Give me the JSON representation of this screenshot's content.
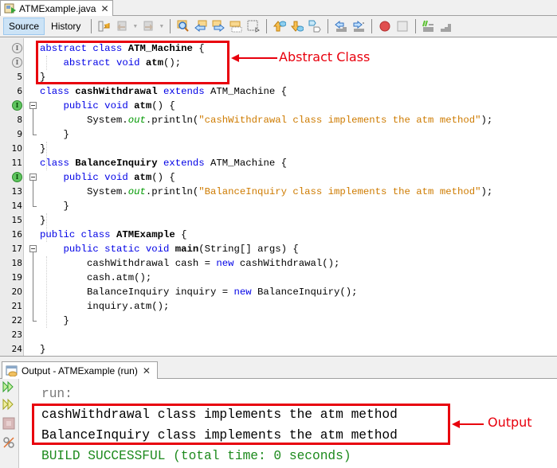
{
  "editor_tab": {
    "filename": "ATMExample.java",
    "close_glyph": "✕",
    "icon": "java-file-icon"
  },
  "toolbar": {
    "source_label": "Source",
    "history_label": "History",
    "icons": [
      "last-edit-icon",
      "back-icon",
      "forward-icon",
      "find-icon",
      "find-previous-icon",
      "find-next-icon",
      "toggle-highlight-icon",
      "rect-select-icon",
      "previous-bookmark-icon",
      "next-bookmark-icon",
      "toggle-bookmark-icon",
      "shift-left-icon",
      "shift-right-icon",
      "start-macro-icon",
      "stop-macro-icon",
      "comment-icon",
      "uncomment-icon"
    ]
  },
  "code": {
    "lines": [
      {
        "n": "",
        "badge": "gray",
        "html": "<span class='kw'>abstract class</span> <span class='b'>ATM_Machine</span> {"
      },
      {
        "n": "",
        "badge": "gray",
        "html": "    <span class='kw'>abstract void</span> <span class='b'>atm</span>();"
      },
      {
        "n": "5",
        "html": "}"
      },
      {
        "n": "6",
        "html": "<span class='kw'>class</span> <span class='b'>cashWithdrawal</span> <span class='kw'>extends</span> ATM_Machine {"
      },
      {
        "n": "",
        "badge": "green",
        "fold": "start",
        "html": "    <span class='kw'>public void</span> <span class='b'>atm</span>() {"
      },
      {
        "n": "8",
        "html": "        System.<span class='fld'>out</span>.println(<span class='str'>\"cashWithdrawal class implements the atm method\"</span>);"
      },
      {
        "n": "9",
        "fold": "end",
        "html": "    }"
      },
      {
        "n": "10",
        "html": "}"
      },
      {
        "n": "11",
        "html": "<span class='kw'>class</span> <span class='b'>BalanceInquiry</span> <span class='kw'>extends</span> ATM_Machine {"
      },
      {
        "n": "",
        "badge": "green",
        "fold": "start",
        "html": "    <span class='kw'>public void</span> <span class='b'>atm</span>() {"
      },
      {
        "n": "13",
        "html": "        System.<span class='fld'>out</span>.println(<span class='str'>\"BalanceInquiry class implements the atm method\"</span>);"
      },
      {
        "n": "14",
        "fold": "end",
        "html": "    }"
      },
      {
        "n": "15",
        "html": "}"
      },
      {
        "n": "16",
        "html": "<span class='kw'>public class</span> <span class='b'>ATMExample</span> {"
      },
      {
        "n": "17",
        "fold": "start",
        "html": "    <span class='kw'>public static void</span> <span class='b'>main</span>(String[] args) {"
      },
      {
        "n": "18",
        "html": "        cashWithdrawal cash = <span class='kw'>new</span> cashWithdrawal();"
      },
      {
        "n": "19",
        "html": "        cash.atm();"
      },
      {
        "n": "20",
        "html": "        BalanceInquiry inquiry = <span class='kw'>new</span> BalanceInquiry();"
      },
      {
        "n": "21",
        "html": "        inquiry.atm();"
      },
      {
        "n": "22",
        "fold": "end",
        "html": "    }"
      },
      {
        "n": "23",
        "html": ""
      },
      {
        "n": "24",
        "html": "}"
      }
    ]
  },
  "annotations": {
    "abstract_label": "Abstract Class",
    "output_label": "Output",
    "color": "#e8000d"
  },
  "output": {
    "tab_title": "Output - ATMExample (run)",
    "close_glyph": "✕",
    "side_icons": [
      "rerun-icon",
      "rerun-with-options-icon",
      "stop-icon",
      "settings-icon"
    ],
    "run_label": "run:",
    "lines": [
      "cashWithdrawal class implements the atm method",
      "BalanceInquiry class implements the atm method"
    ],
    "build_status": "BUILD SUCCESSFUL (total time: 0 seconds)"
  },
  "colors": {
    "keyword": "#0000e6",
    "string": "#ce7b00",
    "field": "#009900",
    "build_success": "#1d8a1d",
    "run_label": "#7a7a7a"
  }
}
